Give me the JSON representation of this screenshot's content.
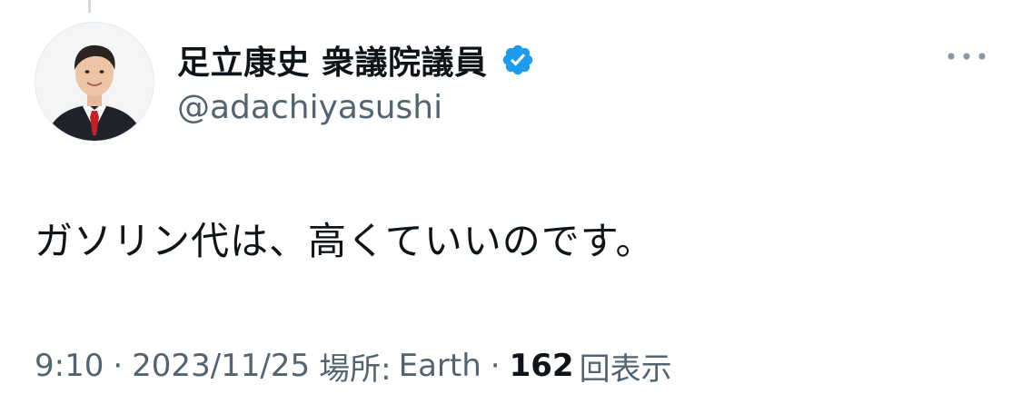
{
  "tweet": {
    "author": {
      "display_name": "足立康史 衆議院議員",
      "handle": "@adachiyasushi",
      "verified": true,
      "avatar_icon": "profile-photo"
    },
    "text": "ガソリン代は、高くていいのです。",
    "meta": {
      "time": "9:10",
      "separator": "·",
      "date": "2023/11/25",
      "location_label": "場所:",
      "location": "Earth",
      "views_count": "162",
      "views_label": "回表示"
    },
    "more_icon": "more-horizontal-icon"
  },
  "colors": {
    "primary_text": "#0f1419",
    "secondary_text": "#536471",
    "verified_blue": "#1d9bf0",
    "background": "#ffffff"
  }
}
